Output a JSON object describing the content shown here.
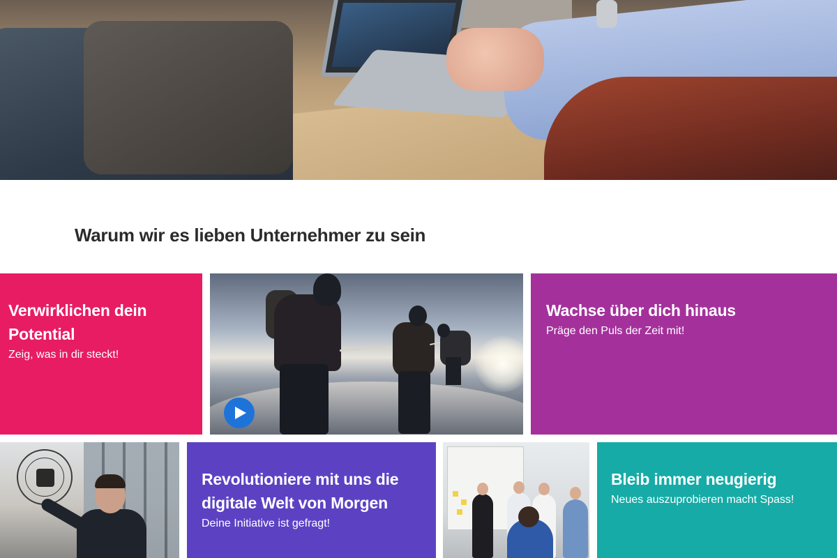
{
  "section": {
    "title": "Warum wir es lieben Unternehmer zu sein"
  },
  "tiles": [
    {
      "title": "Verwirklichen dein Potential",
      "subtitle": "Zeig, was in dir steckt!",
      "color": "#e81c62"
    },
    {
      "type": "video",
      "play_icon": "play-icon",
      "button_color": "#1e73d8"
    },
    {
      "title": "Wachse über dich hinaus",
      "subtitle": "Präge den Puls der Zeit mit!",
      "color": "#a4319b"
    },
    {
      "type": "photo"
    },
    {
      "title": "Revolutioniere mit uns die digitale Welt von Morgen",
      "subtitle": "Deine Initiative ist gefragt!",
      "color": "#5c42c3"
    },
    {
      "type": "photo"
    },
    {
      "title": "Bleib immer neugierig",
      "subtitle": "Neues auszuprobieren macht Spass!",
      "color": "#16aba6"
    }
  ]
}
